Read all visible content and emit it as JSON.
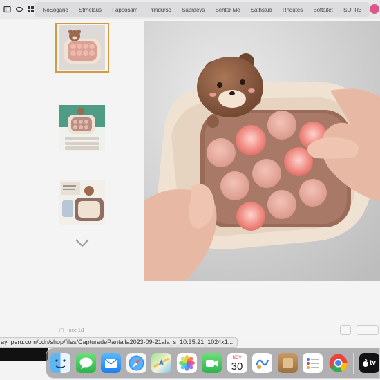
{
  "toolbar": {
    "bookmarks": [
      "NoSogane",
      "Strhelaus",
      "Fapposam",
      "Prindurso",
      "Sabraevs",
      "Sehtor Me",
      "Sathstuo",
      "Rndutes",
      "Boftaitet",
      "SOFR3"
    ]
  },
  "gallery": {
    "thumbnails": [
      {
        "alt": "bear toy thumbnail 1",
        "selected": true
      },
      {
        "alt": "bear toy thumbnail 2",
        "selected": false
      },
      {
        "alt": "bear toy thumbnail 3",
        "selected": false
      }
    ]
  },
  "footer": {
    "hint": "▢ Hoxe 1/1"
  },
  "status_url": "aynperu.com/cdn/shop/files/CapturadePantalla2023-09-21ala_s_10.35.21_1024x1...",
  "dock": {
    "calendar_month": "NOV",
    "calendar_day": "30",
    "tv_label": "tv",
    "apps": [
      "Finder",
      "Messages",
      "Mail",
      "Safari",
      "Maps",
      "Photos",
      "FaceTime",
      "Calendar",
      "Freeform",
      "Notes Tile",
      "Reminders",
      "Chrome",
      "Apple TV"
    ]
  },
  "colors": {
    "accent_selected_border": "#d39a42",
    "toy_cream": "#efe2d2",
    "toy_pink": "#e8a79a",
    "toy_brown": "#8b5e45"
  }
}
